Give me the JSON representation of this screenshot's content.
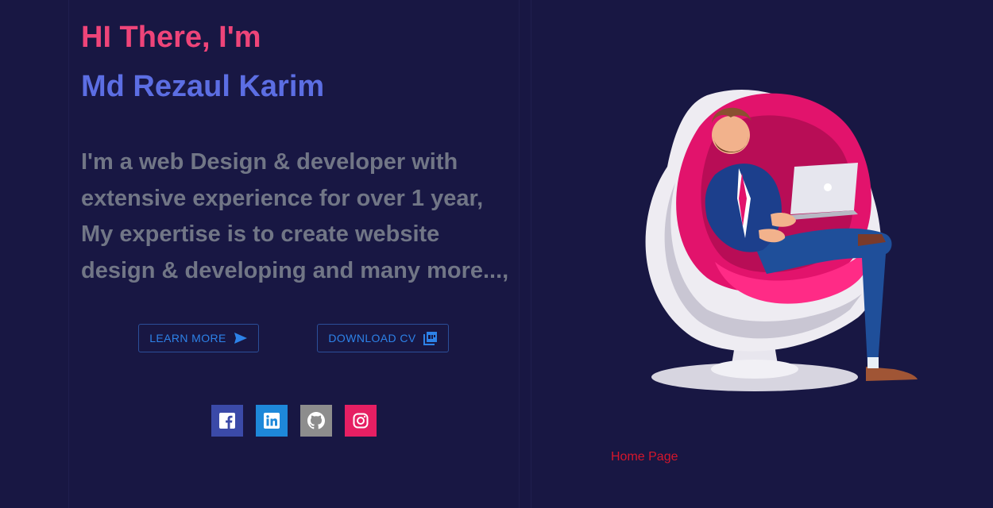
{
  "hero": {
    "greeting": "HI There, I'm",
    "name": "Md Rezaul Karim",
    "bio": "I'm a web Design & developer with extensive experience for over 1 year, My expertise is to create website design & developing and many more...,"
  },
  "buttons": {
    "learn_more": "LEARN MORE",
    "download_cv": "DOWNLOAD CV"
  },
  "social": [
    {
      "name": "facebook",
      "icon": "facebook-icon",
      "color": "#3b4aa8"
    },
    {
      "name": "linkedin",
      "icon": "linkedin-icon",
      "color": "#1e88d9"
    },
    {
      "name": "github",
      "icon": "github-icon",
      "color": "#8d8d8d"
    },
    {
      "name": "instagram",
      "icon": "instagram-icon",
      "color": "#e61f63"
    }
  ],
  "footer": {
    "home_link": "Home Page"
  },
  "colors": {
    "background": "#181743",
    "greeting": "#ee4479",
    "name": "#5c6ee3",
    "bio": "#717686",
    "button": "#2d82e8",
    "link": "#d6162c"
  },
  "illustration": {
    "icon": "man-in-egg-chair-with-laptop-illustration"
  }
}
